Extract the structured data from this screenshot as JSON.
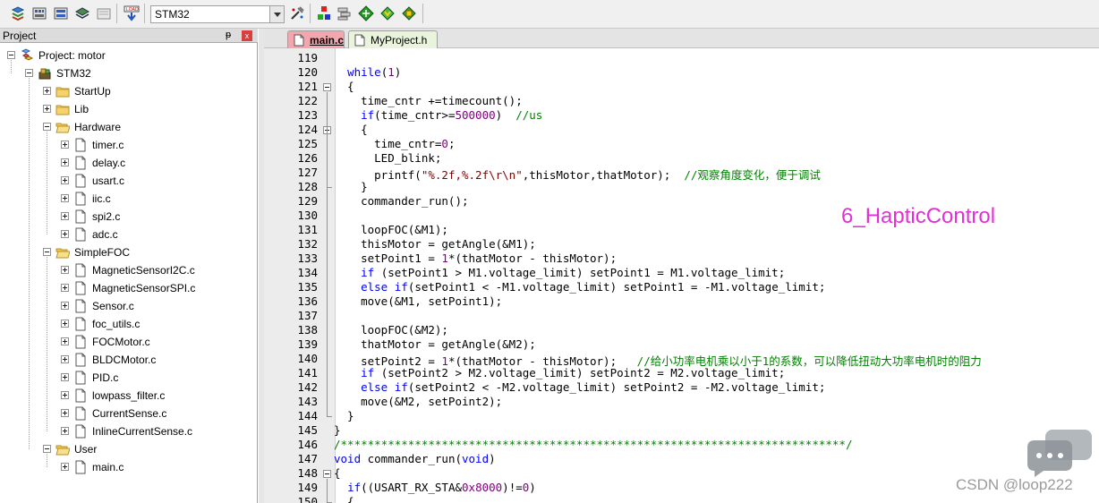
{
  "toolbar": {
    "target": "STM32",
    "buttons": [
      "translate-icon",
      "build-icon",
      "rebuild-icon",
      "batch-build-icon",
      "stop-build-icon",
      "download-icon",
      "options-for-target-icon",
      "manage-components-icon",
      "select-packs-icon",
      "pack-installer-icon",
      "run-time-environment-icon",
      "books-icon"
    ]
  },
  "project_panel": {
    "title": "Project",
    "pin": "ᵽ",
    "close": "x",
    "tree": [
      {
        "label": "Project: motor",
        "level": 0,
        "type": "project",
        "expanded": true
      },
      {
        "label": "STM32",
        "level": 1,
        "type": "target",
        "expanded": true
      },
      {
        "label": "StartUp",
        "level": 2,
        "type": "folder",
        "expanded": false
      },
      {
        "label": "Lib",
        "level": 2,
        "type": "folder",
        "expanded": false
      },
      {
        "label": "Hardware",
        "level": 2,
        "type": "folder",
        "expanded": true
      },
      {
        "label": "timer.c",
        "level": 3,
        "type": "file"
      },
      {
        "label": "delay.c",
        "level": 3,
        "type": "file"
      },
      {
        "label": "usart.c",
        "level": 3,
        "type": "file"
      },
      {
        "label": "iic.c",
        "level": 3,
        "type": "file"
      },
      {
        "label": "spi2.c",
        "level": 3,
        "type": "file"
      },
      {
        "label": "adc.c",
        "level": 3,
        "type": "file"
      },
      {
        "label": "SimpleFOC",
        "level": 2,
        "type": "folder",
        "expanded": true
      },
      {
        "label": "MagneticSensorI2C.c",
        "level": 3,
        "type": "file"
      },
      {
        "label": "MagneticSensorSPI.c",
        "level": 3,
        "type": "file"
      },
      {
        "label": "Sensor.c",
        "level": 3,
        "type": "file"
      },
      {
        "label": "foc_utils.c",
        "level": 3,
        "type": "file"
      },
      {
        "label": "FOCMotor.c",
        "level": 3,
        "type": "file"
      },
      {
        "label": "BLDCMotor.c",
        "level": 3,
        "type": "file"
      },
      {
        "label": "PID.c",
        "level": 3,
        "type": "file"
      },
      {
        "label": "lowpass_filter.c",
        "level": 3,
        "type": "file"
      },
      {
        "label": "CurrentSense.c",
        "level": 3,
        "type": "file"
      },
      {
        "label": "InlineCurrentSense.c",
        "level": 3,
        "type": "file"
      },
      {
        "label": "User",
        "level": 2,
        "type": "folder",
        "expanded": true
      },
      {
        "label": "main.c",
        "level": 3,
        "type": "file"
      }
    ]
  },
  "tabs": [
    {
      "label": "main.c",
      "active": true
    },
    {
      "label": "MyProject.h",
      "active": false
    }
  ],
  "editor": {
    "lines": [
      {
        "n": "119",
        "t": ""
      },
      {
        "n": "120",
        "t": "  <span class='kw'>while</span>(<span class='num'>1</span>)"
      },
      {
        "n": "121",
        "t": "  {"
      },
      {
        "n": "122",
        "t": "    time_cntr +=timecount();"
      },
      {
        "n": "123",
        "t": "    <span class='kw'>if</span>(time_cntr>=<span class='num'>500000</span>)  <span class='cm'>//us</span>"
      },
      {
        "n": "124",
        "t": "    {"
      },
      {
        "n": "125",
        "t": "      time_cntr=<span class='num'>0</span>;"
      },
      {
        "n": "126",
        "t": "      LED_blink;"
      },
      {
        "n": "127",
        "t": "      printf(<span class='str'>\"%.2f,%.2f\\r\\n\"</span>,thisMotor,thatMotor);  <span class='cm'>//观察角度变化，便于调试</span>"
      },
      {
        "n": "128",
        "t": "    }"
      },
      {
        "n": "129",
        "t": "    commander_run();"
      },
      {
        "n": "130",
        "t": ""
      },
      {
        "n": "131",
        "t": "    loopFOC(&M1);"
      },
      {
        "n": "132",
        "t": "    thisMotor = getAngle(&M1);"
      },
      {
        "n": "133",
        "t": "    setPoint1 = <span class='num'>1</span>*(thatMotor - thisMotor);"
      },
      {
        "n": "134",
        "t": "    <span class='kw'>if</span> (setPoint1 > M1.voltage_limit) setPoint1 = M1.voltage_limit;"
      },
      {
        "n": "135",
        "t": "    <span class='kw'>else</span> <span class='kw'>if</span>(setPoint1 < -M1.voltage_limit) setPoint1 = -M1.voltage_limit;"
      },
      {
        "n": "136",
        "t": "    move(&M1, setPoint1);"
      },
      {
        "n": "137",
        "t": ""
      },
      {
        "n": "138",
        "t": "    loopFOC(&M2);"
      },
      {
        "n": "139",
        "t": "    thatMotor = getAngle(&M2);"
      },
      {
        "n": "140",
        "t": "    setPoint2 = <span class='num'>1</span>*(thatMotor - thisMotor);   <span class='cm'>//给小功率电机乘以小于1的系数，可以降低扭动大功率电机时的阻力</span>"
      },
      {
        "n": "141",
        "t": "    <span class='kw'>if</span> (setPoint2 > M2.voltage_limit) setPoint2 = M2.voltage_limit;"
      },
      {
        "n": "142",
        "t": "    <span class='kw'>else</span> <span class='kw'>if</span>(setPoint2 < -M2.voltage_limit) setPoint2 = -M2.voltage_limit;"
      },
      {
        "n": "143",
        "t": "    move(&M2, setPoint2);"
      },
      {
        "n": "144",
        "t": "  }"
      },
      {
        "n": "145",
        "t": "}"
      },
      {
        "n": "146",
        "t": "<span class='cm'>/***************************************************************************/</span>"
      },
      {
        "n": "147",
        "t": "<span class='kw'>void</span> commander_run(<span class='kw'>void</span>)"
      },
      {
        "n": "148",
        "t": "{"
      },
      {
        "n": "149",
        "t": "  <span class='kw'>if</span>((USART_RX_STA&<span class='num'>0x8000</span>)!=<span class='num'>0</span>)"
      },
      {
        "n": "150",
        "t": "  {"
      }
    ]
  },
  "overlay_title": "6_HapticControl",
  "watermark": "CSDN @loop222"
}
